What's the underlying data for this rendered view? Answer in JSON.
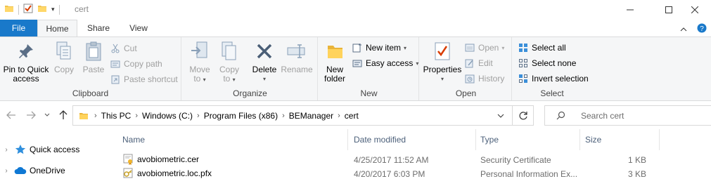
{
  "window": {
    "title": "cert"
  },
  "ribbon_tabs": {
    "file": "File",
    "home": "Home",
    "share": "Share",
    "view": "View"
  },
  "clipboard": {
    "pin_line1": "Pin to Quick",
    "pin_line2": "access",
    "copy": "Copy",
    "paste": "Paste",
    "cut": "Cut",
    "copy_path": "Copy path",
    "paste_shortcut": "Paste shortcut",
    "label": "Clipboard"
  },
  "organize": {
    "move_line1": "Move",
    "move_line2": "to",
    "copy_line1": "Copy",
    "copy_line2": "to",
    "delete": "Delete",
    "rename": "Rename",
    "label": "Organize"
  },
  "new_group": {
    "new_folder_line1": "New",
    "new_folder_line2": "folder",
    "new_item": "New item",
    "easy_access": "Easy access",
    "label": "New"
  },
  "open_group": {
    "properties": "Properties",
    "open": "Open",
    "edit": "Edit",
    "history": "History",
    "label": "Open"
  },
  "select_group": {
    "select_all": "Select all",
    "select_none": "Select none",
    "invert_selection": "Invert selection",
    "label": "Select"
  },
  "address": {
    "crumbs": [
      "This PC",
      "Windows (C:)",
      "Program Files (x86)",
      "BEManager",
      "cert"
    ]
  },
  "search": {
    "placeholder": "Search cert"
  },
  "nav_pane": {
    "quick_access": "Quick access",
    "onedrive": "OneDrive"
  },
  "columns": {
    "name": "Name",
    "date_modified": "Date modified",
    "type": "Type",
    "size": "Size"
  },
  "files": [
    {
      "name": "avobiometric.cer",
      "date": "4/25/2017 11:52 AM",
      "type": "Security Certificate",
      "size": "1 KB",
      "icon": "certificate-icon"
    },
    {
      "name": "avobiometric.loc.pfx",
      "date": "4/20/2017 6:03 PM",
      "type": "Personal Information Ex...",
      "size": "3 KB",
      "icon": "pfx-icon"
    }
  ],
  "colors": {
    "file_tab": "#1979ca",
    "ribbon_bg": "#f5f6f7",
    "header_text": "#4c607a"
  }
}
